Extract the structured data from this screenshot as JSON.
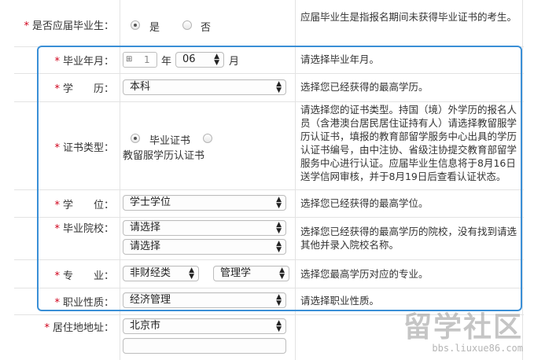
{
  "form": {
    "graduate": {
      "label": "是否应届毕业生：",
      "options": [
        "是",
        "否"
      ],
      "selected": "是",
      "tip": "应届毕业生是指报名期间未获得毕业证书的考生。"
    },
    "grad_date": {
      "label": "毕业年月：",
      "year_icon": "calendar-icon",
      "year_value": "1",
      "year_unit": "年",
      "month_value": "06",
      "month_unit": "月",
      "tip": "请选择毕业年月。"
    },
    "education": {
      "label": "学　　历：",
      "value": "本科",
      "tip": "选择您已经获得的最高学历。"
    },
    "cert_type": {
      "label": "证书类型：",
      "options": [
        "毕业证书",
        "教留服学历认证书"
      ],
      "selected": "毕业证书",
      "tip": "请选择您的证书类型。持国（境）外学历的报名人员（含港澳台居民居住证持有人）请选择教留服学历认证书，填报的教育部留学服务中心出具的学历认证书编号，由中注协、省级注协提交教育部留学服务中心进行认证。应届毕业生信息将于8月16日送学信网审核，并于8月19日后查看认证状态。"
    },
    "degree": {
      "label": "学　　位：",
      "value": "学士学位",
      "tip": "选择您已经获得的最高学位。"
    },
    "school": {
      "label": "毕业院校：",
      "value1": "请选择",
      "value2": "请选择",
      "tip": "选择您已经获得的最高学历的院校，没有找到请选其他并录入院校名称。"
    },
    "major": {
      "label": "专　　业：",
      "value1": "非财经类",
      "value2": "管理学",
      "tip": "选择您最高学历对应的专业。"
    },
    "job": {
      "label": "职业性质：",
      "value": "经济管理",
      "tip": "请选择职业性质。"
    },
    "address": {
      "label": "居住地地址：",
      "value": "北京市"
    },
    "required_mark": "*"
  },
  "watermark": {
    "text": "留学社区",
    "url": "bbs.liuxue86.com"
  },
  "colors": {
    "required": "#d0021b",
    "highlight_border": "#3a8fd6"
  }
}
